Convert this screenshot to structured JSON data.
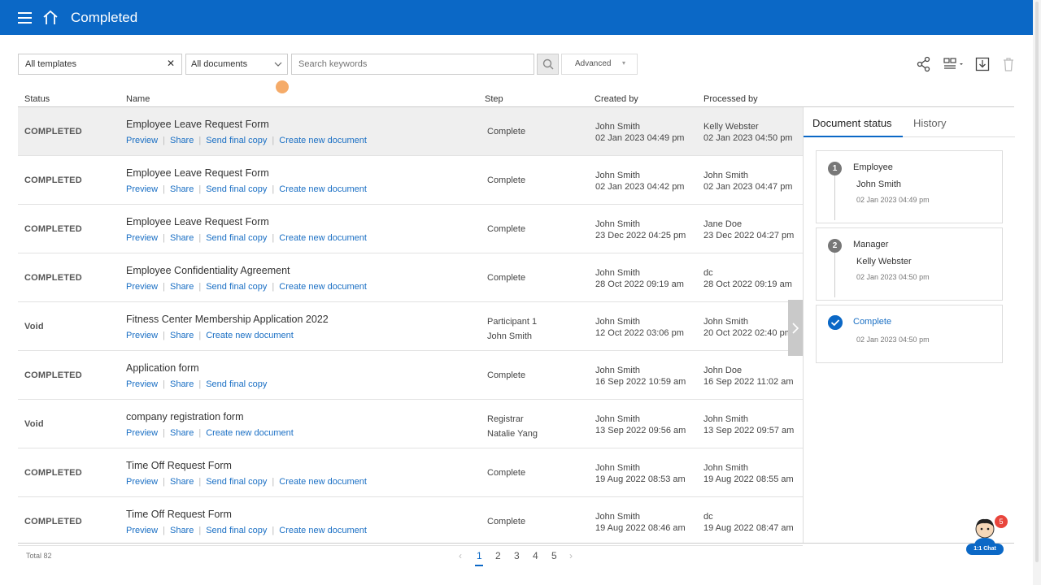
{
  "header": {
    "title": "Completed"
  },
  "filters": {
    "template_value": "All templates",
    "clear_symbol": "✕",
    "documents_value": "All documents",
    "search_placeholder": "Search keywords",
    "advanced_label": "Advanced"
  },
  "columns": {
    "status": "Status",
    "name": "Name",
    "step": "Step",
    "created_by": "Created by",
    "processed_by": "Processed by"
  },
  "link_labels": {
    "preview": "Preview",
    "share": "Share",
    "send_final_copy": "Send final copy",
    "create_new_document": "Create new document"
  },
  "rows": [
    {
      "status": "COMPLETED",
      "name": "Employee Leave Request Form",
      "step": "Complete",
      "step2": "",
      "created_by": "John Smith",
      "created_at": "02 Jan 2023 04:49 pm",
      "processed_by": "Kelly Webster",
      "processed_at": "02 Jan 2023 04:50 pm",
      "links": [
        "preview",
        "share",
        "send_final_copy",
        "create_new_document"
      ],
      "selected": true
    },
    {
      "status": "COMPLETED",
      "name": "Employee Leave Request Form",
      "step": "Complete",
      "step2": "",
      "created_by": "John Smith",
      "created_at": "02 Jan 2023 04:42 pm",
      "processed_by": "John Smith",
      "processed_at": "02 Jan 2023 04:47 pm",
      "links": [
        "preview",
        "share",
        "send_final_copy",
        "create_new_document"
      ]
    },
    {
      "status": "COMPLETED",
      "name": "Employee Leave Request Form",
      "step": "Complete",
      "step2": "",
      "created_by": "John Smith",
      "created_at": "23 Dec 2022 04:25 pm",
      "processed_by": "Jane Doe",
      "processed_at": "23 Dec 2022 04:27 pm",
      "links": [
        "preview",
        "share",
        "send_final_copy",
        "create_new_document"
      ]
    },
    {
      "status": "COMPLETED",
      "name": "Employee Confidentiality Agreement",
      "step": "Complete",
      "step2": "",
      "created_by": "John Smith",
      "created_at": "28 Oct 2022 09:19 am",
      "processed_by": "dc",
      "processed_at": "28 Oct 2022 09:19 am",
      "links": [
        "preview",
        "share",
        "send_final_copy",
        "create_new_document"
      ]
    },
    {
      "status": "Void",
      "name": "Fitness Center Membership Application 2022",
      "step": "Participant 1",
      "step2": "John Smith",
      "created_by": "John Smith",
      "created_at": "12 Oct 2022 03:06 pm",
      "processed_by": "John Smith",
      "processed_at": "20 Oct 2022 02:40 pm",
      "links": [
        "preview",
        "share",
        "create_new_document"
      ]
    },
    {
      "status": "COMPLETED",
      "name": "Application form",
      "step": "Complete",
      "step2": "",
      "created_by": "John Smith",
      "created_at": "16 Sep 2022 10:59 am",
      "processed_by": "John Doe",
      "processed_at": "16 Sep 2022 11:02 am",
      "links": [
        "preview",
        "share",
        "send_final_copy"
      ]
    },
    {
      "status": "Void",
      "name": "company registration form",
      "step": "Registrar",
      "step2": "Natalie Yang",
      "created_by": "John Smith",
      "created_at": "13 Sep 2022 09:56 am",
      "processed_by": "John Smith",
      "processed_at": "13 Sep 2022 09:57 am",
      "links": [
        "preview",
        "share",
        "create_new_document"
      ]
    },
    {
      "status": "COMPLETED",
      "name": "Time Off Request Form",
      "step": "Complete",
      "step2": "",
      "created_by": "John Smith",
      "created_at": "19 Aug 2022 08:53 am",
      "processed_by": "John Smith",
      "processed_at": "19 Aug 2022 08:55 am",
      "links": [
        "preview",
        "share",
        "send_final_copy",
        "create_new_document"
      ]
    },
    {
      "status": "COMPLETED",
      "name": "Time Off Request Form",
      "step": "Complete",
      "step2": "",
      "created_by": "John Smith",
      "created_at": "19 Aug 2022 08:46 am",
      "processed_by": "dc",
      "processed_at": "19 Aug 2022 08:47 am",
      "links": [
        "preview",
        "share",
        "send_final_copy",
        "create_new_document"
      ]
    }
  ],
  "panel": {
    "tab_status": "Document status",
    "tab_history": "History",
    "steps": [
      {
        "num": "1",
        "role": "Employee",
        "person": "John Smith",
        "time": "02 Jan 2023 04:49 pm"
      },
      {
        "num": "2",
        "role": "Manager",
        "person": "Kelly Webster",
        "time": "02 Jan 2023 04:50 pm"
      }
    ],
    "complete": {
      "label": "Complete",
      "time": "02 Jan 2023 04:50 pm"
    }
  },
  "footer": {
    "total": "Total 82",
    "pages": [
      "1",
      "2",
      "3",
      "4",
      "5"
    ],
    "current_page": "1",
    "prev_glyph": "‹",
    "next_glyph": "›"
  },
  "chat": {
    "label": "1:1 Chat",
    "badge": "5"
  },
  "colors": {
    "primary": "#0b68c6",
    "link": "#1a6fc4",
    "badge": "#e8453c",
    "selected_row": "#efefef"
  }
}
